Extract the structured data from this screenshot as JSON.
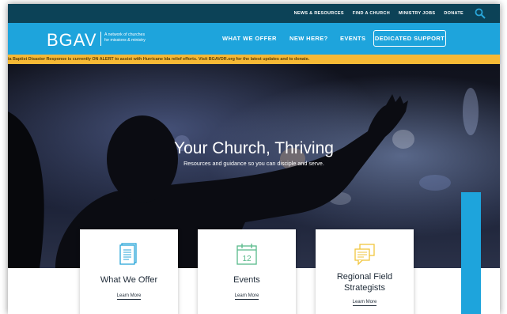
{
  "utility_nav": [
    "NEWS & RESOURCES",
    "FIND A CHURCH",
    "MINISTRY JOBS",
    "DONATE"
  ],
  "header": {
    "logo": "BGAV",
    "tagline_line1": "A network of churches",
    "tagline_line2": "for missions & ministry",
    "nav": [
      "WHAT WE OFFER",
      "NEW HERE?",
      "EVENTS"
    ],
    "cta": "DEDICATED SUPPORT"
  },
  "alert": "ia Baptist Disaster Response is currently ON ALERT to assist with Hurricane Ida relief efforts. Visit BGAVDR.org for the latest updates and to donate.",
  "hero": {
    "title": "Your Church, Thriving",
    "subtitle": "Resources and guidance so you can disciple and serve."
  },
  "cards": [
    {
      "icon": "document-icon",
      "title_line1": "What We Offer",
      "title_line2": "",
      "link": "Learn More"
    },
    {
      "icon": "calendar-icon",
      "calendar_day": "12",
      "title_line1": "Events",
      "title_line2": "",
      "link": "Learn More"
    },
    {
      "icon": "chat-bubbles-icon",
      "title_line1": "Regional Field",
      "title_line2": "Strategists",
      "link": "Learn More"
    }
  ],
  "colors": {
    "utility_bar": "#0c4257",
    "main_nav": "#1ea4dc",
    "alert_bar": "#f6b935",
    "icon_teal": "#29a6d9",
    "icon_green": "#58b98a",
    "icon_yellow": "#f2c53d"
  }
}
